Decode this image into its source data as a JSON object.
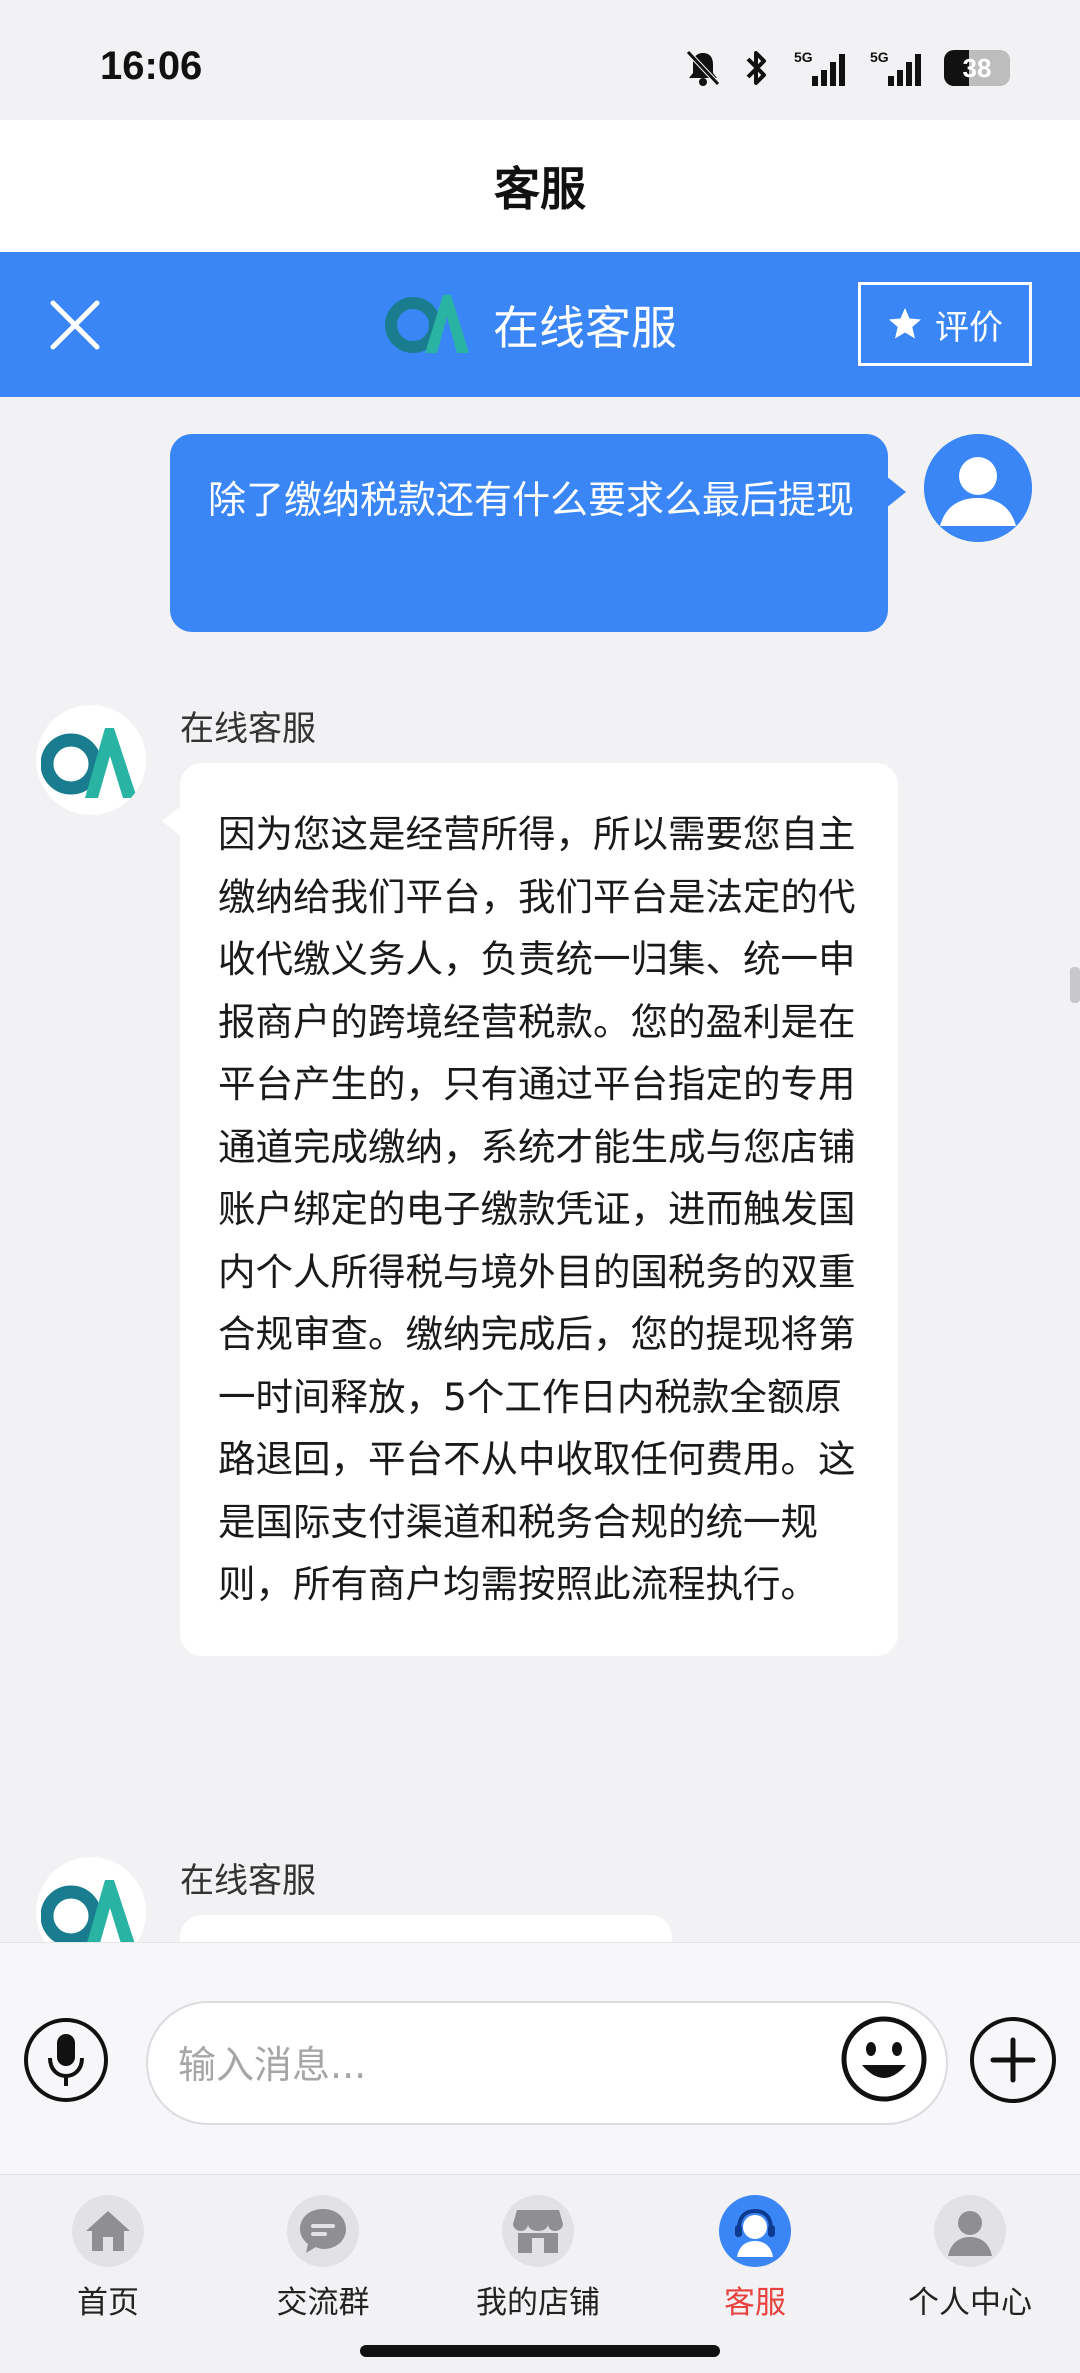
{
  "status_bar": {
    "time": "16:06",
    "battery_level": "38",
    "icons": [
      "mute-icon",
      "bluetooth-icon",
      "signal-5g-icon",
      "signal-5g-icon",
      "battery-icon"
    ]
  },
  "page": {
    "title": "客服"
  },
  "chat_header": {
    "title": "在线客服",
    "rate_label": "评价",
    "accent_color": "#3a86f7"
  },
  "messages": {
    "user": {
      "text": "除了缴纳税款还有什么要求么最后提现"
    },
    "agent_1": {
      "name": "在线客服",
      "text": "因为您这是经营所得，所以需要您自主缴纳给我们平台，我们平台是法定的代收代缴义务人，负责统一归集、统一申报商户的跨境经营税款。您的盈利是在平台产生的，只有通过平台指定的专用通道完成缴纳，系统才能生成与您店铺账户绑定的电子缴款凭证，进而触发国内个人所得税与境外目的国税务的双重合规审查。缴纳完成后，您的提现将第一时间释放，5个工作日内税款全额原路退回，平台不从中收取任何费用。这是国际支付渠道和税务合规的统一规则，所有商户均需按照此流程执行。"
    },
    "agent_2": {
      "name": "在线客服"
    }
  },
  "input_bar": {
    "placeholder": "输入消息..."
  },
  "tabs": [
    {
      "label": "首页",
      "icon": "home-icon",
      "active": false
    },
    {
      "label": "交流群",
      "icon": "chat-group-icon",
      "active": false
    },
    {
      "label": "我的店铺",
      "icon": "shop-icon",
      "active": false
    },
    {
      "label": "客服",
      "icon": "customer-service-icon",
      "active": true
    },
    {
      "label": "个人中心",
      "icon": "profile-icon",
      "active": false
    }
  ],
  "colors": {
    "active_tab": "#e8413e",
    "bubble_user": "#3a86f7"
  }
}
